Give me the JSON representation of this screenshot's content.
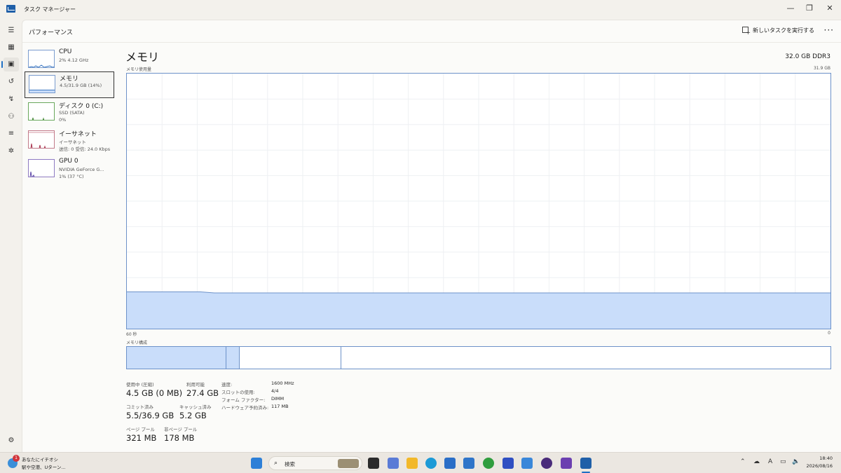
{
  "window": {
    "title": "タスク マネージャー",
    "minimize": "—",
    "restore": "❐",
    "close": "✕"
  },
  "header": {
    "title": "パフォーマンス",
    "run_task": "新しいタスクを実行する",
    "more": "···"
  },
  "devices": [
    {
      "name": "CPU",
      "line1": "2% 4.12 GHz",
      "line2": ""
    },
    {
      "name": "メモリ",
      "line1": "4.5/31.9 GB (14%)",
      "line2": ""
    },
    {
      "name": "ディスク 0 (C:)",
      "line1": "SSD (SATA)",
      "line2": "0%"
    },
    {
      "name": "イーサネット",
      "line1": "イーサネット",
      "line2": "送信: 0 受信: 24.0 Kbps"
    },
    {
      "name": "GPU 0",
      "line1": "NVIDIA GeForce G...",
      "line2": "1% (37 °C)"
    }
  ],
  "memory": {
    "title": "メモリ",
    "total": "32.0 GB DDR3",
    "chart_label": "メモリ使用量",
    "chart_max": "31.9 GB",
    "axis_left": "60 秒",
    "axis_right": "0",
    "composition_label": "メモリ構成",
    "usage_fraction": 0.14,
    "stats": {
      "in_use_label": "使用中 (圧縮)",
      "in_use_value": "4.5 GB (0 MB)",
      "available_label": "利用可能",
      "available_value": "27.4 GB",
      "committed_label": "コミット済み",
      "committed_value": "5.5/36.9 GB",
      "cached_label": "キャッシュ済み",
      "cached_value": "5.2 GB",
      "paged_label": "ページ プール",
      "paged_value": "321 MB",
      "nonpaged_label": "非ページ プール",
      "nonpaged_value": "178 MB"
    },
    "details": [
      {
        "label": "速度:",
        "value": "1600 MHz"
      },
      {
        "label": "スロットの使用:",
        "value": "4/4"
      },
      {
        "label": "フォーム ファクター:",
        "value": "DIMM"
      },
      {
        "label": "ハードウェア予約済み:",
        "value": "117 MB"
      }
    ]
  },
  "taskbar": {
    "weather_title": "あなたにイチオシ",
    "weather_sub": "駅や空港、Uターン...",
    "badge": "1",
    "search_placeholder": "検索",
    "time": "18:40",
    "date": "2026/08/16",
    "ime": "A"
  },
  "colors": {
    "accent": "#1f6fc4",
    "chart_line": "#6d92c9",
    "chart_fill": "#c9ddfa",
    "grid": "#eef0f3"
  }
}
